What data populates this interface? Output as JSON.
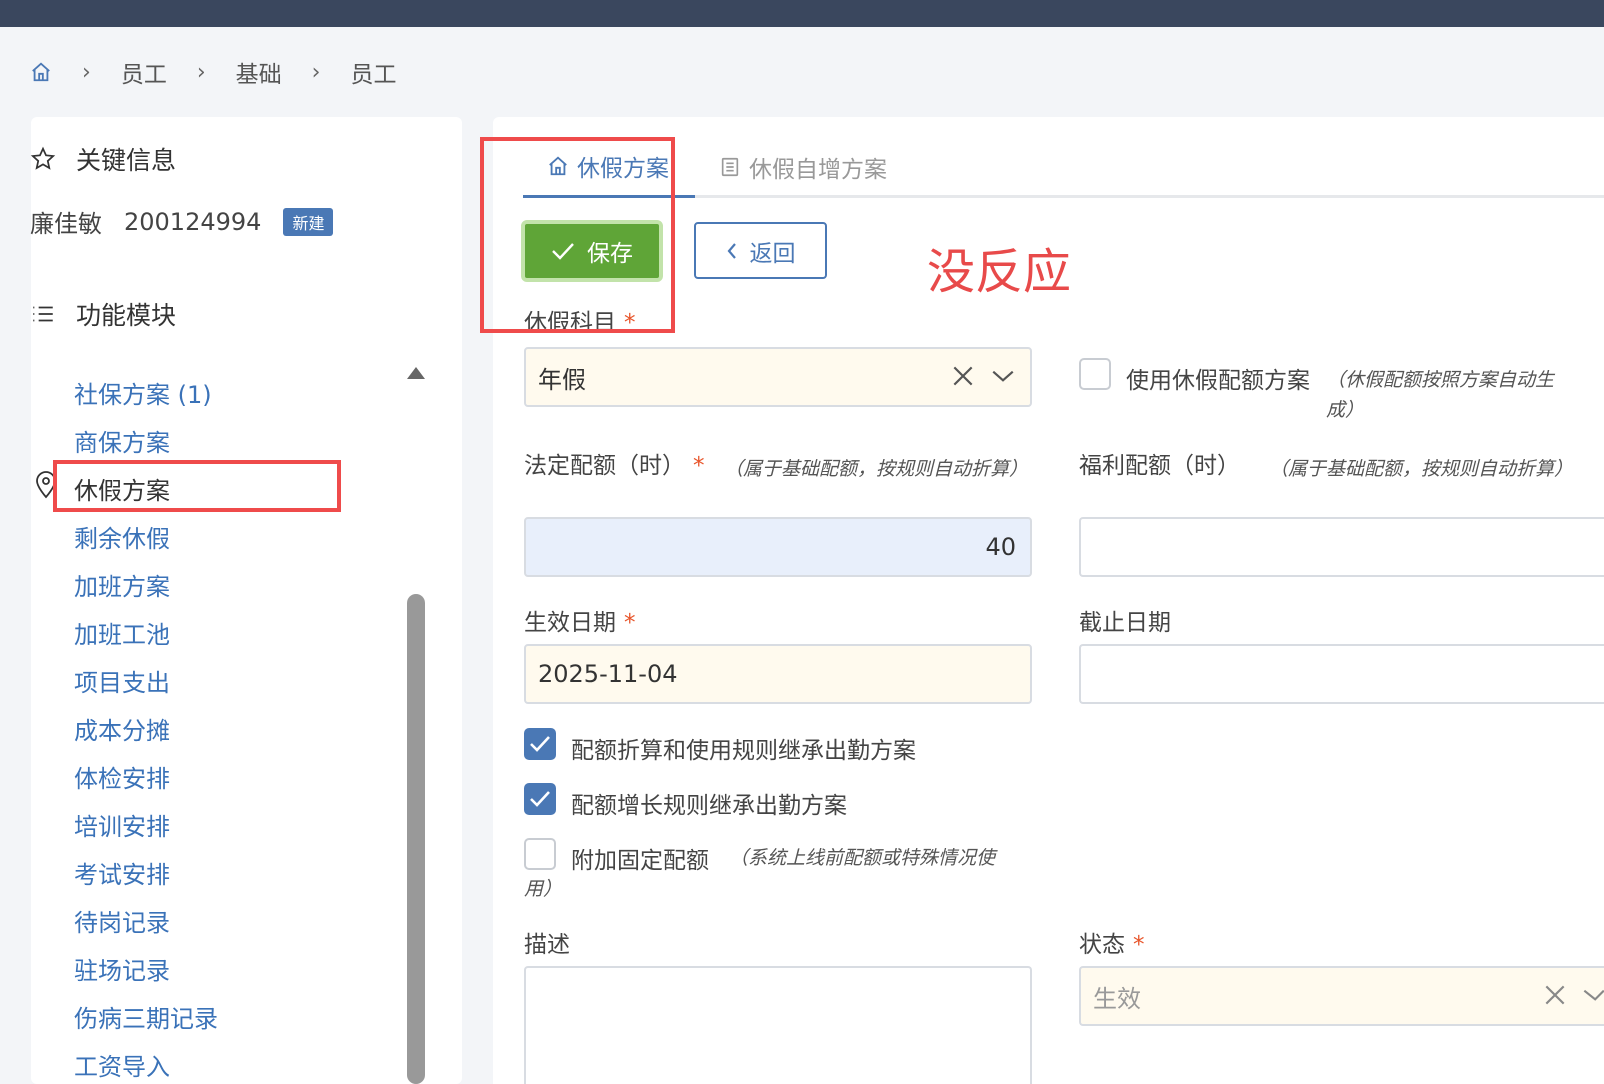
{
  "breadcrumb": {
    "items": [
      "员工",
      "基础",
      "员工"
    ]
  },
  "sidebar": {
    "key_info_title": "关键信息",
    "employee_name": "廉佳敏",
    "employee_id": "200124994",
    "badge": "新建",
    "modules_title": "功能模块",
    "items": [
      {
        "label": "社保方案 (1)"
      },
      {
        "label": "商保方案"
      },
      {
        "label": "休假方案"
      },
      {
        "label": "剩余休假"
      },
      {
        "label": "加班方案"
      },
      {
        "label": "加班工池"
      },
      {
        "label": "项目支出"
      },
      {
        "label": "成本分摊"
      },
      {
        "label": "体检安排"
      },
      {
        "label": "培训安排"
      },
      {
        "label": "考试安排"
      },
      {
        "label": "待岗记录"
      },
      {
        "label": "驻场记录"
      },
      {
        "label": "伤病三期记录"
      },
      {
        "label": "工资导入"
      }
    ],
    "active_index": 2
  },
  "tabs": [
    {
      "label": "休假方案",
      "active": true
    },
    {
      "label": "休假自增方案",
      "active": false
    }
  ],
  "toolbar": {
    "save_label": "保存",
    "back_label": "返回"
  },
  "annotation": {
    "text": "没反应",
    "color": "#e84a4a"
  },
  "form": {
    "leave_subject": {
      "label": "休假科目",
      "value": "年假"
    },
    "use_quota_plan": {
      "label": "使用休假配额方案",
      "hint": "（休假配额按照方案自动生成）",
      "checked": false
    },
    "statutory_quota": {
      "label": "法定配额（时）",
      "hint": "（属于基础配额，按规则自动折算）",
      "value": "40"
    },
    "welfare_quota": {
      "label": "福利配额（时）",
      "hint": "（属于基础配额，按规则自动折算）",
      "value": ""
    },
    "effective_date": {
      "label": "生效日期",
      "value": "2025-11-04"
    },
    "end_date": {
      "label": "截止日期",
      "value": ""
    },
    "inherit_conversion": {
      "label": "配额折算和使用规则继承出勤方案",
      "checked": true
    },
    "inherit_growth": {
      "label": "配额增长规则继承出勤方案",
      "checked": true
    },
    "fixed_quota": {
      "label": "附加固定配额",
      "hint": "（系统上线前配额或特殊情况使用）",
      "checked": false
    },
    "description": {
      "label": "描述",
      "value": ""
    },
    "status": {
      "label": "状态",
      "value": "生效"
    }
  },
  "colors": {
    "primary": "#4a78b5",
    "save": "#5fa537",
    "required": "#e8552b",
    "annotation_box": "#ef4b4b"
  }
}
